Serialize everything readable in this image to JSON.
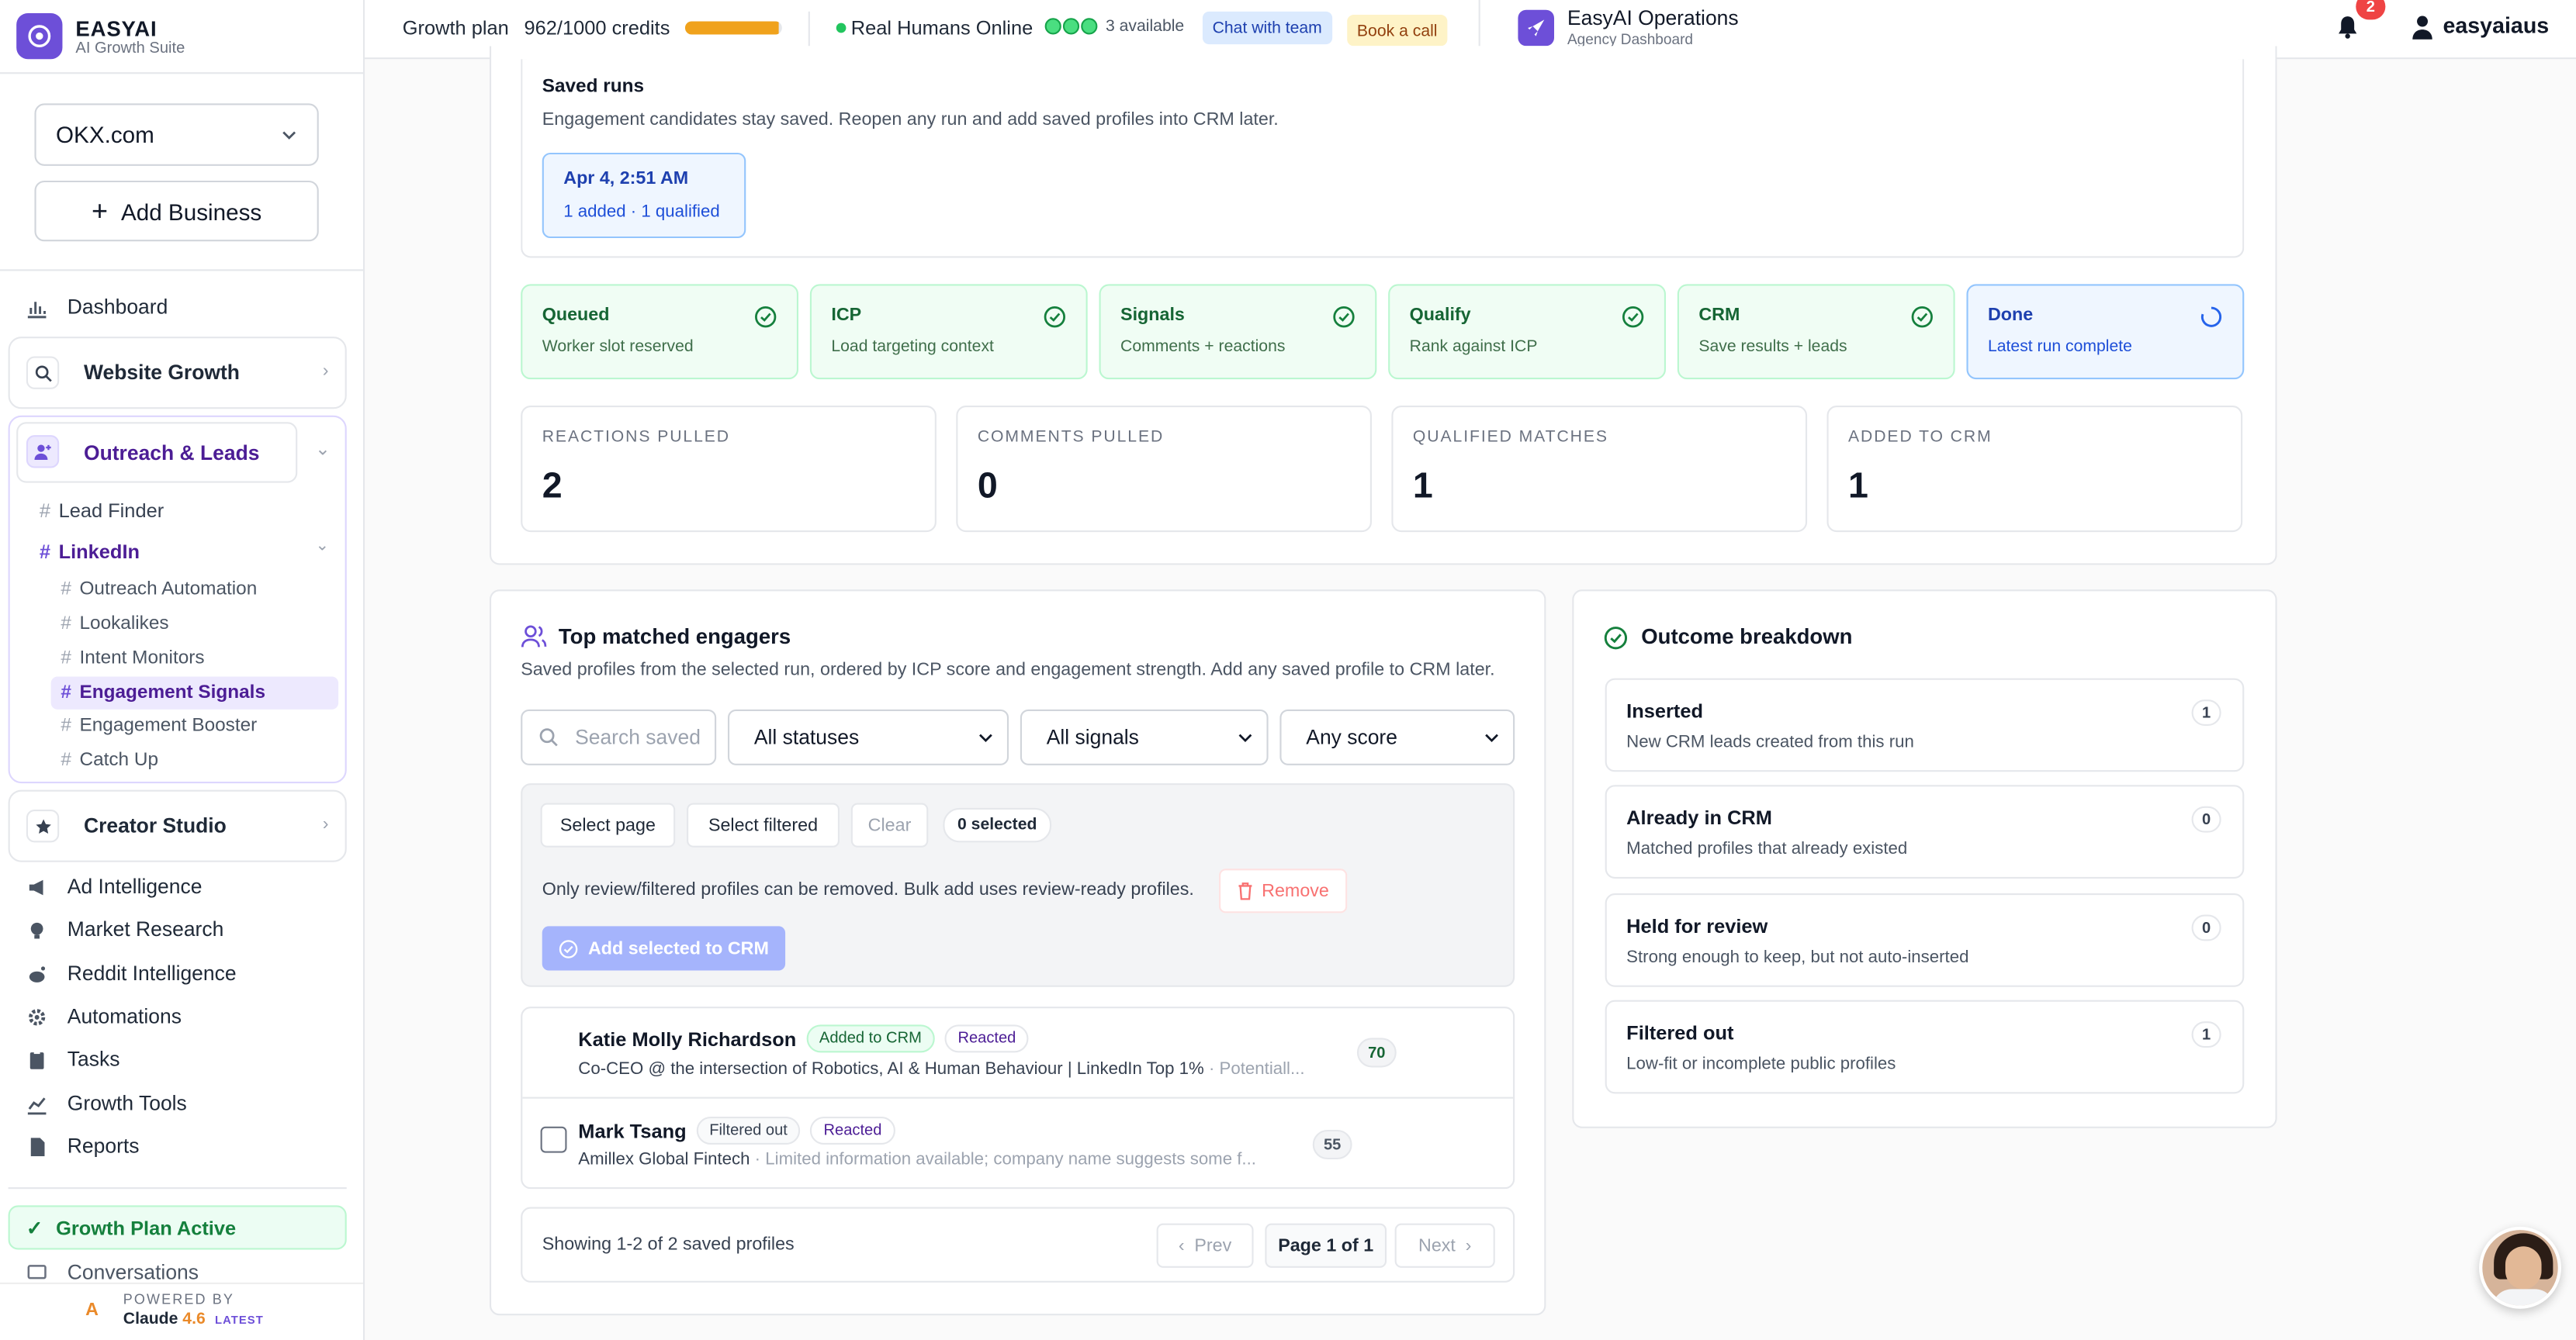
{
  "brand": {
    "name": "EASYAI",
    "sub": "AI Growth Suite"
  },
  "business": {
    "selected": "OKX.com",
    "add_label": "Add Business"
  },
  "nav": {
    "dashboard": "Dashboard",
    "website_growth": "Website Growth",
    "outreach_leads": "Outreach & Leads",
    "lead_finder": "Lead Finder",
    "linkedin": "LinkedIn",
    "linkedin_items": [
      "Outreach Automation",
      "Lookalikes",
      "Intent Monitors",
      "Engagement Signals",
      "Engagement Booster",
      "Catch Up"
    ],
    "creator_studio": "Creator Studio",
    "items": [
      "Ad Intelligence",
      "Market Research",
      "Reddit Intelligence",
      "Automations",
      "Tasks",
      "Growth Tools",
      "Reports"
    ],
    "plan_active": "Growth Plan Active",
    "conversations": "Conversations"
  },
  "powered": {
    "label": "POWERED BY",
    "model": "Claude",
    "version": "4.6",
    "tag": "LATEST"
  },
  "header": {
    "plan_label": "Growth plan",
    "credits": "962/1000 credits",
    "credits_fraction": 0.962,
    "humans": "Real Humans Online",
    "available": "3 available",
    "chat": "Chat with team",
    "book": "Book a call",
    "org_name": "EasyAI Operations",
    "org_sub": "Agency Dashboard",
    "notif_count": "2",
    "username": "easyaiaus"
  },
  "saved_runs": {
    "title": "Saved runs",
    "desc": "Engagement candidates stay saved. Reopen any run and add saved profiles into CRM later.",
    "run_date": "Apr 4, 2:51 AM",
    "run_meta": "1 added · 1 qualified"
  },
  "steps": [
    {
      "title": "Queued",
      "desc": "Worker slot reserved"
    },
    {
      "title": "ICP",
      "desc": "Load targeting context"
    },
    {
      "title": "Signals",
      "desc": "Comments + reactions"
    },
    {
      "title": "Qualify",
      "desc": "Rank against ICP"
    },
    {
      "title": "CRM",
      "desc": "Save results + leads"
    },
    {
      "title": "Done",
      "desc": "Latest run complete"
    }
  ],
  "metrics": [
    {
      "label": "REACTIONS PULLED",
      "value": "2"
    },
    {
      "label": "COMMENTS PULLED",
      "value": "0"
    },
    {
      "label": "QUALIFIED MATCHES",
      "value": "1"
    },
    {
      "label": "ADDED TO CRM",
      "value": "1"
    }
  ],
  "engagers": {
    "title": "Top matched engagers",
    "desc": "Saved profiles from the selected run, ordered by ICP score and engagement strength. Add any saved profile to CRM later.",
    "search_placeholder": "Search saved",
    "status_filter": "All statuses",
    "signal_filter": "All signals",
    "score_filter": "Any score",
    "select_page": "Select page",
    "select_filtered": "Select filtered",
    "clear": "Clear",
    "selected_count": "0 selected",
    "note": "Only review/filtered profiles can be removed. Bulk add uses review-ready profiles.",
    "remove": "Remove",
    "add_selected": "Add selected to CRM",
    "rows": [
      {
        "name": "Katie Molly Richardson",
        "status": "Added to CRM",
        "signal": "Reacted",
        "headline": "Co-CEO @ the intersection of Robotics, AI & Human Behaviour | LinkedIn Top 1%",
        "extra": " · Potentiall...",
        "score": "70"
      },
      {
        "name": "Mark Tsang",
        "status": "Filtered out",
        "signal": "Reacted",
        "headline": "Amillex Global Fintech",
        "extra": " · Limited information available; company name suggests some f...",
        "score": "55"
      }
    ],
    "showing": "Showing 1-2 of 2 saved profiles",
    "prev": "Prev",
    "page": "Page 1 of 1",
    "next": "Next"
  },
  "outcome": {
    "title": "Outcome breakdown",
    "items": [
      {
        "title": "Inserted",
        "desc": "New CRM leads created from this run",
        "count": "1"
      },
      {
        "title": "Already in CRM",
        "desc": "Matched profiles that already existed",
        "count": "0"
      },
      {
        "title": "Held for review",
        "desc": "Strong enough to keep, but not auto-inserted",
        "count": "0"
      },
      {
        "title": "Filtered out",
        "desc": "Low-fit or incomplete public profiles",
        "count": "1"
      }
    ]
  }
}
